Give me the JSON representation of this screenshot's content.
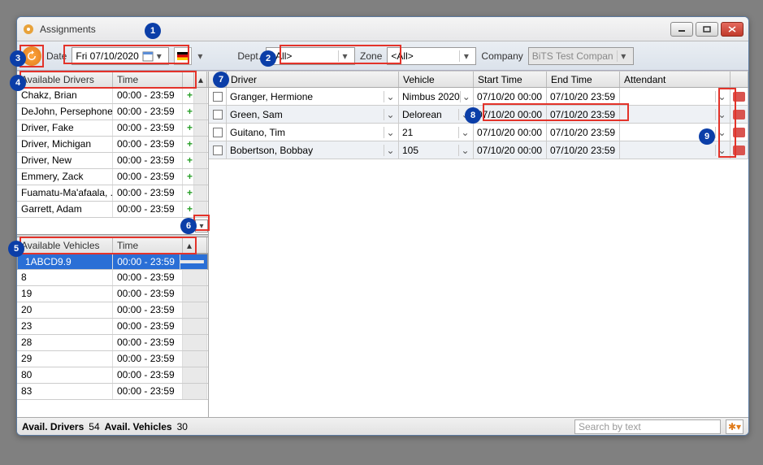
{
  "window": {
    "title": "Assignments"
  },
  "toolbar": {
    "date_label": "Date",
    "date_value": "Fri  07/10/2020",
    "dept_label": "Dept.",
    "dept_value": "<All>",
    "zone_label": "Zone",
    "zone_value": "<All>",
    "company_label": "Company",
    "company_value": "BiTS Test Company"
  },
  "drivers": {
    "hdr_name": "Available Drivers",
    "hdr_time": "Time",
    "rows": [
      {
        "name": "Chakz, Brian",
        "time": "00:00 - 23:59"
      },
      {
        "name": "DeJohn, Persephone",
        "time": "00:00 - 23:59"
      },
      {
        "name": "Driver, Fake",
        "time": "00:00 - 23:59"
      },
      {
        "name": "Driver, Michigan",
        "time": "00:00 - 23:59"
      },
      {
        "name": "Driver, New",
        "time": "00:00 - 23:59"
      },
      {
        "name": "Emmery, Zack",
        "time": "00:00 - 23:59"
      },
      {
        "name": "Fuamatu-Ma'afaala, ...",
        "time": "00:00 - 23:59"
      },
      {
        "name": "Garrett, Adam",
        "time": "00:00 - 23:59"
      }
    ]
  },
  "vehicles": {
    "hdr_name": "Available Vehicles",
    "hdr_time": "Time",
    "rows": [
      {
        "name": "1ABCD9.9",
        "time": "00:00 - 23:59",
        "selected": true
      },
      {
        "name": "8",
        "time": "00:00 - 23:59"
      },
      {
        "name": "19",
        "time": "00:00 - 23:59"
      },
      {
        "name": "20",
        "time": "00:00 - 23:59"
      },
      {
        "name": "23",
        "time": "00:00 - 23:59"
      },
      {
        "name": "28",
        "time": "00:00 - 23:59"
      },
      {
        "name": "29",
        "time": "00:00 - 23:59"
      },
      {
        "name": "80",
        "time": "00:00 - 23:59"
      },
      {
        "name": "83",
        "time": "00:00 - 23:59"
      }
    ]
  },
  "assign": {
    "hdr_driver": "Driver",
    "hdr_vehicle": "Vehicle",
    "hdr_start": "Start Time",
    "hdr_end": "End Time",
    "hdr_attendant": "Attendant",
    "rows": [
      {
        "driver": "Granger, Hermione",
        "vehicle": "Nimbus 2020",
        "start": "07/10/20 00:00",
        "end": "07/10/20 23:59"
      },
      {
        "driver": "Green, Sam",
        "vehicle": "Delorean",
        "start": "07/10/20 00:00",
        "end": "07/10/20 23:59"
      },
      {
        "driver": "Guitano, Tim",
        "vehicle": "21",
        "start": "07/10/20 00:00",
        "end": "07/10/20 23:59"
      },
      {
        "driver": "Bobertson, Bobbay",
        "vehicle": "105",
        "start": "07/10/20 00:00",
        "end": "07/10/20 23:59"
      }
    ]
  },
  "status": {
    "drv_label": "Avail. Drivers",
    "drv_count": "54",
    "veh_label": "Avail. Vehicles",
    "veh_count": "30",
    "search_ph": "Search by text"
  },
  "annotations": [
    "1",
    "2",
    "3",
    "4",
    "5",
    "6",
    "7",
    "8",
    "9"
  ]
}
